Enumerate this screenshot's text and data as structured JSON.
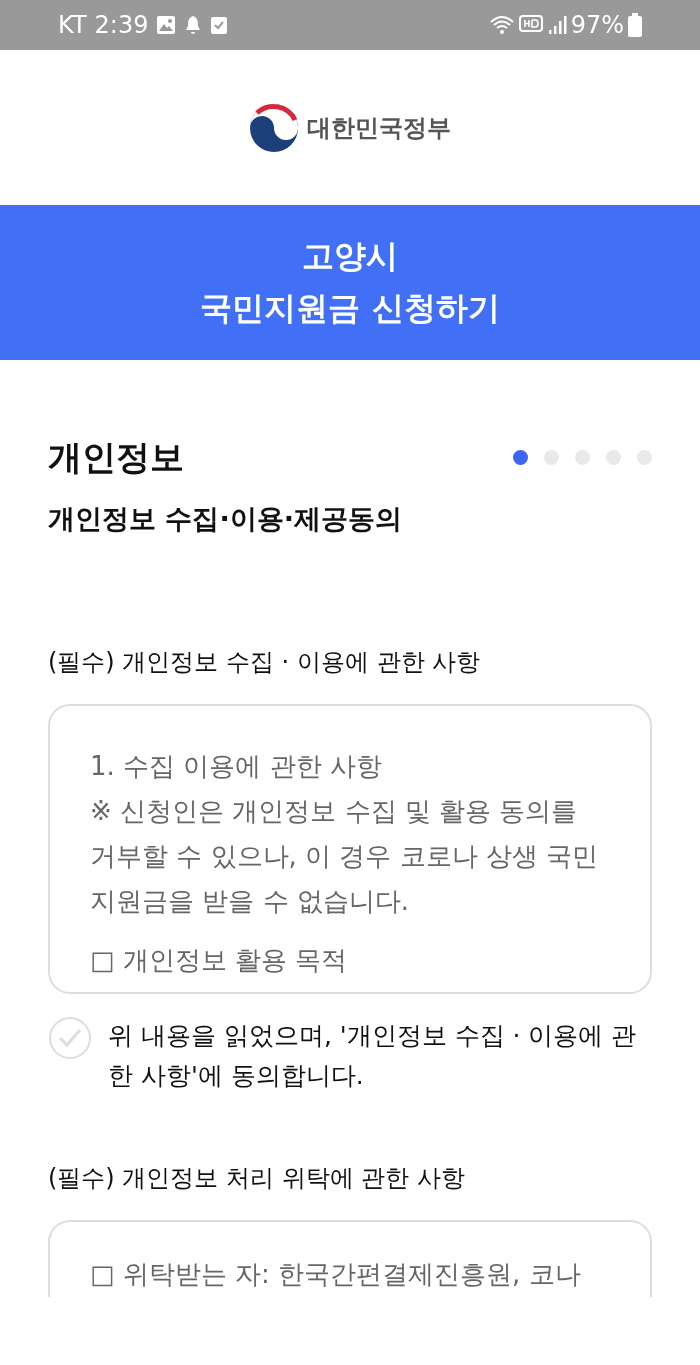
{
  "status_bar": {
    "carrier": "KT",
    "time": "2:39",
    "battery": "97%"
  },
  "header": {
    "logo_text": "대한민국정부"
  },
  "banner": {
    "lines": [
      "고양시",
      "국민지원금 신청하기"
    ]
  },
  "page": {
    "title": "개인정보",
    "subtitle": "개인정보 수집·이용·제공동의",
    "steps": [
      {
        "selected": true
      },
      {
        "selected": false
      },
      {
        "selected": false
      },
      {
        "selected": false
      },
      {
        "selected": false
      }
    ]
  },
  "sections": [
    {
      "label": "(필수) 개인정보 수집 · 이용에 관한 사항",
      "box_lines": [
        "1. 수집 이용에 관한 사항",
        "※ 신청인은 개인정보 수집 및 활용 동의를 거부할 수 있으나, 이 경우 코로나 상생 국민 지원금을 받을 수 없습니다.",
        "□ 개인정보 활용 목적"
      ],
      "agreement": {
        "text": "위 내용을 읽었으며, '개인정보 수집 · 이용에 관한 사항'에 동의합니다.",
        "checked": false
      }
    },
    {
      "label": "(필수) 개인정보 처리 위탁에 관한 사항",
      "box_lines": [
        "□ 위탁받는 자: 한국간편결제진흥원, 코나"
      ]
    }
  ]
}
